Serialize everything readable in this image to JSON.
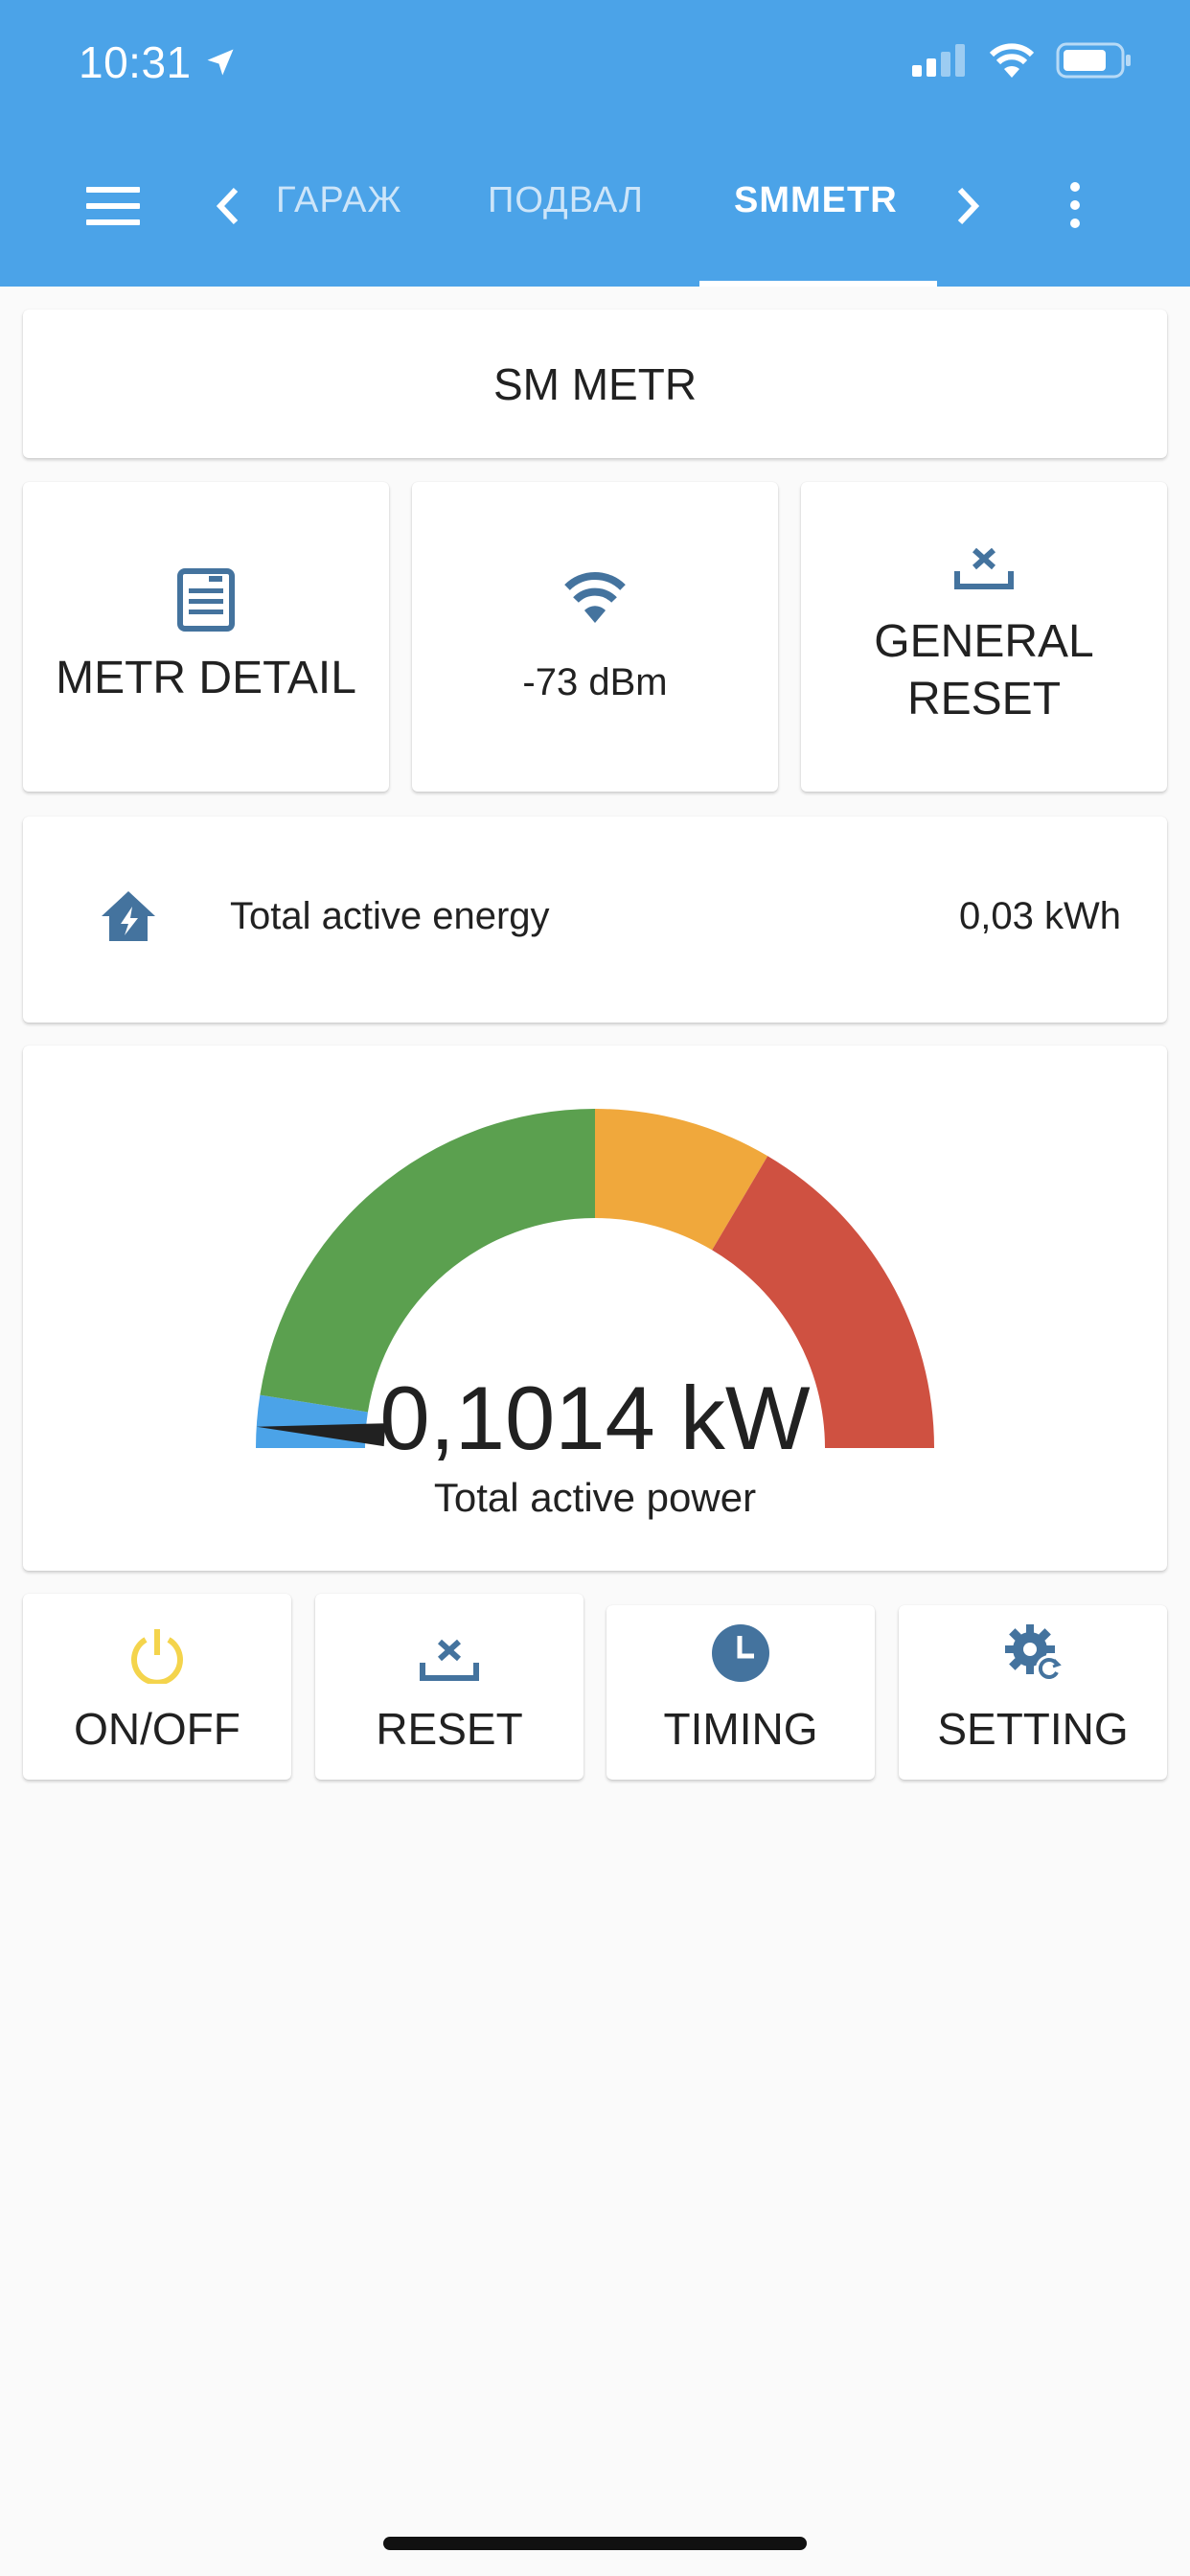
{
  "status_bar": {
    "time": "10:31"
  },
  "toolbar": {
    "tabs": [
      {
        "label": "ГАРАЖ"
      },
      {
        "label": "ПОДВАЛ"
      },
      {
        "label": "SMMETR"
      }
    ],
    "active_tab": "SMMETR"
  },
  "title": "SM METR",
  "tiles": {
    "detail": {
      "label": "METR DETAIL",
      "icon": "document-icon"
    },
    "wifi": {
      "state": "-73 dBm",
      "icon": "wifi-icon"
    },
    "general_reset": {
      "label": "GENERAL RESET",
      "icon": "tray-remove-icon"
    }
  },
  "energy": {
    "name": "Total active energy",
    "value": "0,03 kWh",
    "icon": "home-lightning-icon"
  },
  "gauge": {
    "value": "0,1014 kW",
    "name": "Total active power",
    "level": 0.02,
    "segments": [
      {
        "from": 0.0,
        "to": 0.05,
        "color": "#4ba3e8"
      },
      {
        "from": 0.05,
        "to": 0.5,
        "color": "#5ba04f"
      },
      {
        "from": 0.5,
        "to": 0.67,
        "color": "#f0a83c"
      },
      {
        "from": 0.67,
        "to": 1.0,
        "color": "#cf5141"
      }
    ]
  },
  "buttons": {
    "onoff": {
      "label": "ON/OFF",
      "icon": "power-icon",
      "color": "#f4d44c"
    },
    "reset": {
      "label": "RESET",
      "icon": "tray-remove-icon"
    },
    "timing": {
      "label": "TIMING",
      "icon": "clock-icon"
    },
    "setting": {
      "label": "SETTING",
      "icon": "cog-refresh-icon"
    }
  },
  "colors": {
    "header": "#4ba3e8",
    "icon": "#44739e"
  }
}
